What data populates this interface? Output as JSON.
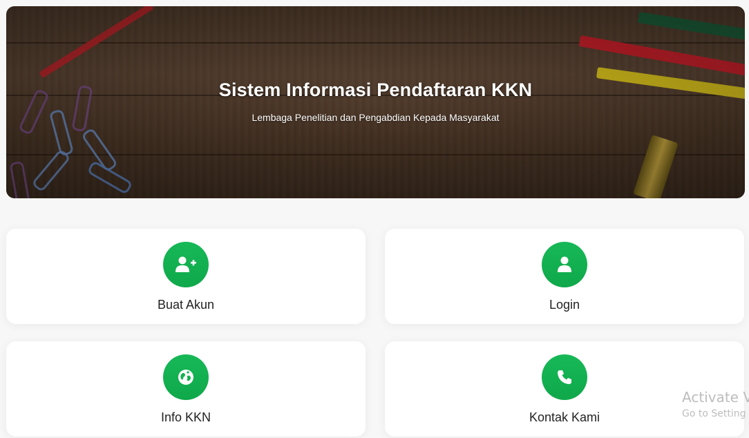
{
  "hero": {
    "title": "Sistem Informasi Pendaftaran KKN",
    "subtitle": "Lembaga Penelitian dan Pengabdian Kepada Masyarakat"
  },
  "cards": [
    {
      "label": "Buat Akun",
      "icon": "user-plus-icon"
    },
    {
      "label": "Login",
      "icon": "user-icon"
    },
    {
      "label": "Info KKN",
      "icon": "globe-icon"
    },
    {
      "label": "Kontak Kami",
      "icon": "phone-icon"
    }
  ],
  "theme": {
    "accent": "#13b24f",
    "card_bg": "#ffffff",
    "page_bg": "#f7f7f7"
  },
  "watermark": {
    "line1": "Activate V",
    "line2": "Go to Setting"
  }
}
